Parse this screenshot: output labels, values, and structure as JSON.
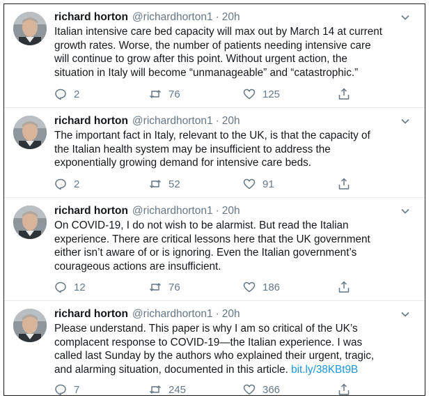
{
  "tweets": [
    {
      "name": "richard horton",
      "handle": "@richardhorton1",
      "separator": "·",
      "time": "20h",
      "text": "Italian intensive care bed capacity will max out by March 14 at current\ngrowth rates. Worse, the number of patients needing intensive care\nwill continue to grow after this point. Without urgent action, the\nsituation in Italy will become “unmanageable” and “catastrophic.”",
      "link": "",
      "replies": "2",
      "retweets": "76",
      "likes": "125"
    },
    {
      "name": "richard horton",
      "handle": "@richardhorton1",
      "separator": "·",
      "time": "20h",
      "text": "The important fact in Italy, relevant to the UK, is that the capacity of\nthe Italian health system may be insufficient to address the\nexponentially growing demand for intensive care beds.",
      "link": "",
      "replies": "2",
      "retweets": "52",
      "likes": "91"
    },
    {
      "name": "richard horton",
      "handle": "@richardhorton1",
      "separator": "·",
      "time": "20h",
      "text": "On COVID-19, I do not wish to be alarmist. But read the Italian\nexperience. There are critical lessons here that the UK government\neither isn’t aware of or is ignoring. Even the Italian government’s\ncourageous actions are insufficient.",
      "link": "",
      "replies": "12",
      "retweets": "76",
      "likes": "186"
    },
    {
      "name": "richard horton",
      "handle": "@richardhorton1",
      "separator": "·",
      "time": "20h",
      "text": "Please understand. This paper is why I am so critical of the UK’s\ncomplacent response to COVID-19—the Italian experience. I was\ncalled last Sunday by the authors who explained their urgent, tragic,\nand alarming situation, documented in this article. ",
      "link": "bit.ly/38KBt9B",
      "replies": "7",
      "retweets": "245",
      "likes": "366"
    }
  ],
  "icons": {
    "avatar": "avatar-photo",
    "menu": "chevron-down-icon",
    "reply": "reply-icon",
    "retweet": "retweet-icon",
    "like": "heart-icon",
    "share": "share-icon"
  },
  "colors": {
    "name": "#14171a",
    "secondary": "#657786",
    "link": "#1b95e0",
    "divider": "#e6ecf0"
  }
}
